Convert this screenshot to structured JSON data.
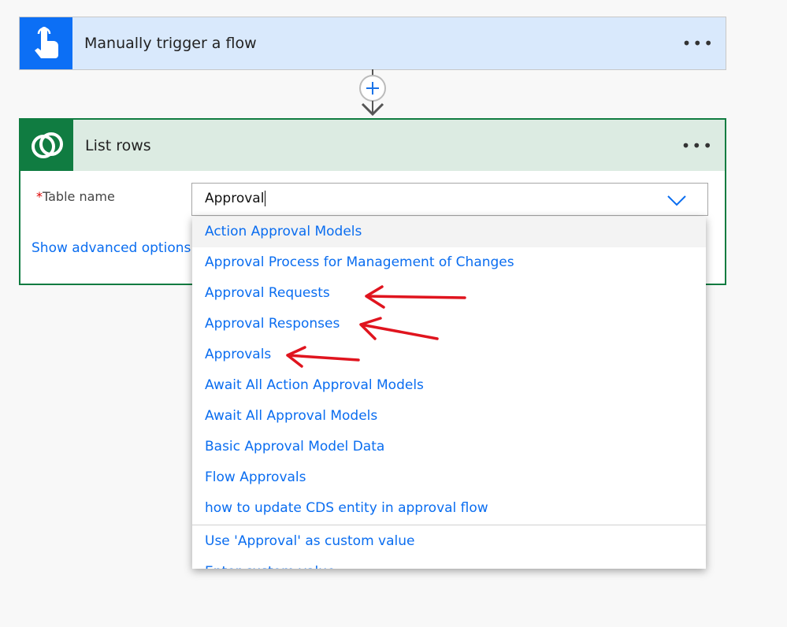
{
  "trigger": {
    "title": "Manually trigger a flow",
    "icon": "hand-pointer-icon",
    "more": "•••",
    "color": "#0c6ff5"
  },
  "action": {
    "title": "List rows",
    "icon": "dataverse-icon",
    "more": "•••",
    "color": "#107c41",
    "field_label": "Table name",
    "required_mark": "*",
    "field_value": "Approval",
    "show_advanced": "Show advanced options"
  },
  "dropdown": {
    "options": [
      "Action Approval Models",
      "Approval Process for Management of Changes",
      "Approval Requests",
      "Approval Responses",
      "Approvals",
      "Await All Action Approval Models",
      "Await All Approval Models",
      "Basic Approval Model Data",
      "Flow Approvals",
      "how to update CDS entity in approval flow"
    ],
    "custom_options": [
      "Use 'Approval' as custom value",
      "Enter custom value"
    ]
  },
  "annotations": {
    "arrow_color": "#e0141e",
    "marked_options": [
      "Approval Requests",
      "Approval Responses",
      "Approvals"
    ]
  }
}
